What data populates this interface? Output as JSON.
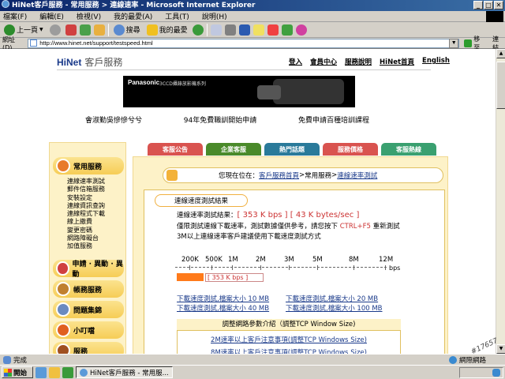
{
  "window": {
    "title": "HiNet客戶服務 - 常用服務 > 連線速率 - Microsoft Internet Explorer",
    "buttons": {
      "minimize": "_",
      "maximize": "□",
      "close": "✕"
    }
  },
  "menu": [
    "檔案(F)",
    "編輯(E)",
    "檢視(V)",
    "我的最愛(A)",
    "工具(T)",
    "說明(H)"
  ],
  "toolbar": {
    "back": "上一頁",
    "search": "搜尋",
    "favorites": "我的最愛"
  },
  "address": {
    "label": "網址(D)",
    "url": "http://www.hinet.net/support/testspeed.html",
    "go": "移至",
    "links": "連結"
  },
  "header": {
    "logo": "HiNet",
    "logo_service": "客戶服務",
    "links": [
      "登入",
      "會員中心",
      "服務說明",
      "HiNet首頁",
      "English"
    ]
  },
  "banner": {
    "brand": "Panasonic",
    "text": "3CCD攝錄放影機系列"
  },
  "promos": [
    "會淑勤吳慘慘兮兮",
    "94年免費職訓開始申請",
    "免費申請百種培訓課程"
  ],
  "tabs": [
    {
      "label": "客服公告",
      "color": "#d9534f"
    },
    {
      "label": "企業客服",
      "color": "#4a8a2a"
    },
    {
      "label": "熱門話題",
      "color": "#2a7a9a"
    },
    {
      "label": "服務價格",
      "color": "#d9534f"
    },
    {
      "label": "客服熱線",
      "color": "#3aa070"
    }
  ],
  "sidebar": {
    "head1": "常用服務",
    "items": [
      "連線速率測試",
      "郵件信箱服務",
      "安裝設定",
      "連線資訊查詢",
      "連線程式下載",
      "線上繳費",
      "變更密碼",
      "網路障礙台",
      "加值服務"
    ],
    "head2": "申請 · 異動 · 異動",
    "head3": "帳務服務",
    "head4": "問題集錦",
    "head5": "小叮噹",
    "head6": "服務"
  },
  "breadcrumb": {
    "prefix": "您現在位在：",
    "home": "客戶服務首頁",
    "sep1": " > ",
    "section": "常用服務",
    "sep2": " > ",
    "current": "連線速率測試"
  },
  "result": {
    "title": "連線速度測試結果",
    "label": "連線速率測試結果：",
    "value": "[ 353 K bps ] [ 43 K bytes/sec ]",
    "note_a": "僅限測試連線下載速率，測試數據僅供參考，請您按下",
    "note_key": "CTRL+F5",
    "note_b": "重新測試",
    "note2": "3M以上連線速率客戶建議使用下載速度測試方式"
  },
  "scale": {
    "ticks": [
      "200K",
      "500K",
      "1M",
      "2M",
      "3M",
      "5M",
      "8M",
      "12M"
    ],
    "unit": "bps",
    "bar_label": "[ 353 K bps ]",
    "measured_kbps": 353
  },
  "downloads": [
    "下載速度測試,檔案大小 10 MB",
    "下載速度測試,檔案大小 20 MB",
    "下載速度測試,檔案大小 40 MB",
    "下載速度測試,檔案大小 100 MB"
  ],
  "tuning": {
    "head": "調整網路參數介紹（調整TCP Window Size)",
    "link1": "2M速率以上客戶注意事項(調整TCP Windows Size)",
    "link2": "8M速率以上客戶注意事項(調整TCP Windows Size)"
  },
  "status": {
    "left": "完成",
    "zone": "網際網路"
  },
  "taskbar": {
    "start": "開始",
    "task1": "HiNet客戶服務 - 常用服...",
    "tray_time": "",
    "watermark": "#17657"
  }
}
